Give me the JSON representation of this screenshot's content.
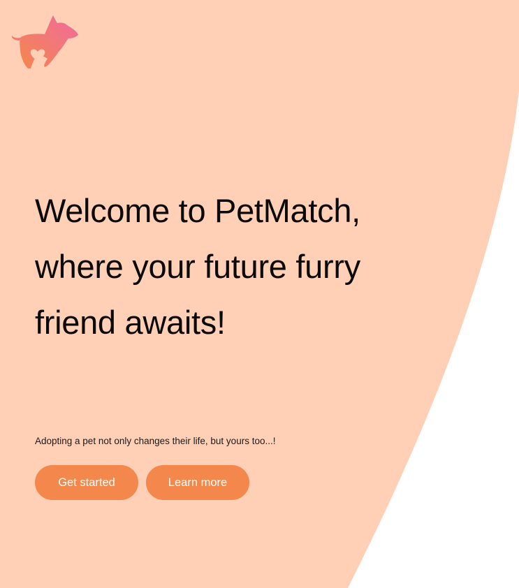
{
  "brand": {
    "logo_icon": "dog-heart-logo-icon",
    "gradient_from": "#f4874b",
    "gradient_to": "#f06aa0"
  },
  "hero": {
    "title": "Welcome to PetMatch, where your future furry friend awaits!",
    "subtitle": "Adopting a pet not only changes their life, but yours too...!"
  },
  "actions": {
    "get_started_label": "Get started",
    "learn_more_label": "Learn more"
  },
  "colors": {
    "background_shape": "#ffcfb6",
    "page_background": "#ffffff",
    "button": "#f4874b",
    "button_text": "#ffffff",
    "text": "#0a0a0a"
  }
}
